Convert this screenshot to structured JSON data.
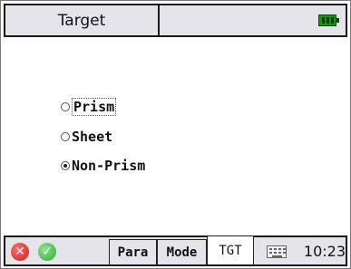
{
  "window": {
    "title": "Target",
    "battery_color": "#1f8f1f"
  },
  "target_options": [
    {
      "label": "Prism",
      "checked": false
    },
    {
      "label": "Sheet",
      "checked": false
    },
    {
      "label": "Non-Prism",
      "checked": true
    }
  ],
  "bottombar": {
    "cancel_icon": "red-x",
    "ok_icon": "green-check",
    "tabs": [
      {
        "label": "Para"
      },
      {
        "label": "Mode"
      },
      {
        "label": "TGT"
      }
    ],
    "keyboard_icon": "keyboard",
    "clock": "10:23"
  }
}
